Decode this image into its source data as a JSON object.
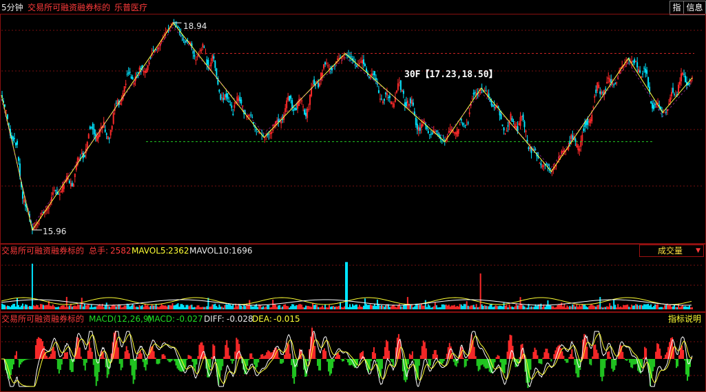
{
  "header": {
    "period": "5分钟",
    "index_name": "交易所可融资融券标的",
    "stock_name": "乐普医疗",
    "btn_index": "指",
    "btn_info": "信息"
  },
  "price_chart": {
    "high_label": "18.94",
    "low_label": "15.96",
    "range_label": "30F【17.23,18.50】"
  },
  "volume_panel": {
    "title": "交易所可融资融券标的",
    "total_label": "总手:",
    "total_value": "2582",
    "mavol5_label": "MAVOL5:",
    "mavol5_value": "2362",
    "mavol10_label": "MAVOL10:",
    "mavol10_value": "1696",
    "dropdown_label": "成交量"
  },
  "macd_panel": {
    "title": "交易所可融资融券标的",
    "macd_params": "MACD(12,26,9)",
    "macd_label": "MACD:",
    "macd_value": "-0.027",
    "diff_label": "DIFF:",
    "diff_value": "-0.028",
    "dea_label": "DEA:",
    "dea_value": "-0.015",
    "help_label": "指标说明"
  },
  "colors": {
    "up": "#ff2a2a",
    "down": "#00e5ff",
    "zigzag": "#ffff44",
    "support": "#22cc22",
    "resistance": "#cc2222",
    "diff_line": "#ffffff",
    "dea_line": "#ffff33"
  },
  "chart_data": {
    "type": "line",
    "description_note": "",
    "ylim": [
      15.8,
      19.05
    ],
    "zigzag_points": [
      {
        "i": 0,
        "price": 17.9
      },
      {
        "i": 45,
        "price": 15.96
      },
      {
        "i": 250,
        "price": 18.94
      },
      {
        "i": 382,
        "price": 17.29
      },
      {
        "i": 500,
        "price": 18.5
      },
      {
        "i": 645,
        "price": 17.23
      },
      {
        "i": 698,
        "price": 18.0
      },
      {
        "i": 800,
        "price": 16.8
      },
      {
        "i": 912,
        "price": 18.43
      },
      {
        "i": 962,
        "price": 17.65
      },
      {
        "i": 1005,
        "price": 18.15
      }
    ],
    "horizontal_levels": [
      {
        "price": 18.5,
        "style": "resistance"
      },
      {
        "price": 17.23,
        "style": "support"
      }
    ],
    "volume_spikes": [
      {
        "i": 45,
        "value": 2.8
      },
      {
        "i": 502,
        "value": 2.9
      },
      {
        "i": 697,
        "value": 2.2
      }
    ]
  }
}
